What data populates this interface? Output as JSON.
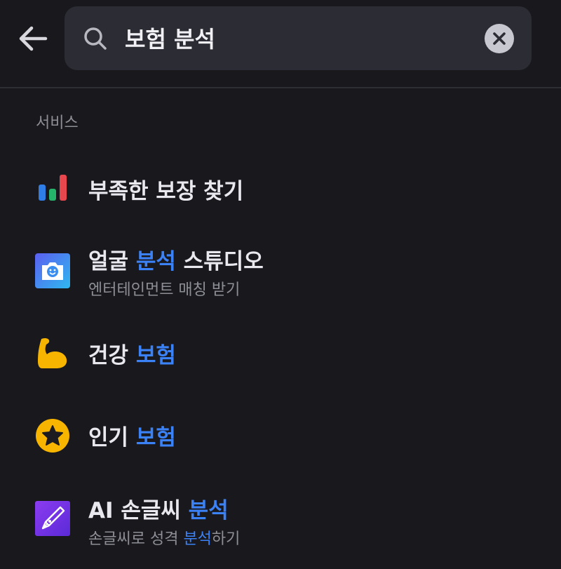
{
  "search": {
    "query": "보험 분석",
    "placeholder": ""
  },
  "section_label": "서비스",
  "results": [
    {
      "icon": "bar-chart-icon",
      "title_pre": "부족한 보장 찾기",
      "title_hl": "",
      "title_post": "",
      "sub_pre": "",
      "sub_hl": "",
      "sub_post": ""
    },
    {
      "icon": "camera-face-icon",
      "title_pre": "얼굴 ",
      "title_hl": "분석",
      "title_post": " 스튜디오",
      "sub_pre": "엔터테인먼트 매칭 받기",
      "sub_hl": "",
      "sub_post": ""
    },
    {
      "icon": "flexed-bicep-icon",
      "title_pre": "건강 ",
      "title_hl": "보험",
      "title_post": "",
      "sub_pre": "",
      "sub_hl": "",
      "sub_post": ""
    },
    {
      "icon": "star-badge-icon",
      "title_pre": "인기 ",
      "title_hl": "보험",
      "title_post": "",
      "sub_pre": "",
      "sub_hl": "",
      "sub_post": ""
    },
    {
      "icon": "fountain-pen-icon",
      "title_pre": "AI 손글씨 ",
      "title_hl": "분석",
      "title_post": "",
      "sub_pre": "손글씨로 성격 ",
      "sub_hl": "분석",
      "sub_post": "하기"
    }
  ],
  "colors": {
    "background": "#18181d",
    "highlight": "#3b82f6",
    "search_box": "#2c2c34"
  }
}
